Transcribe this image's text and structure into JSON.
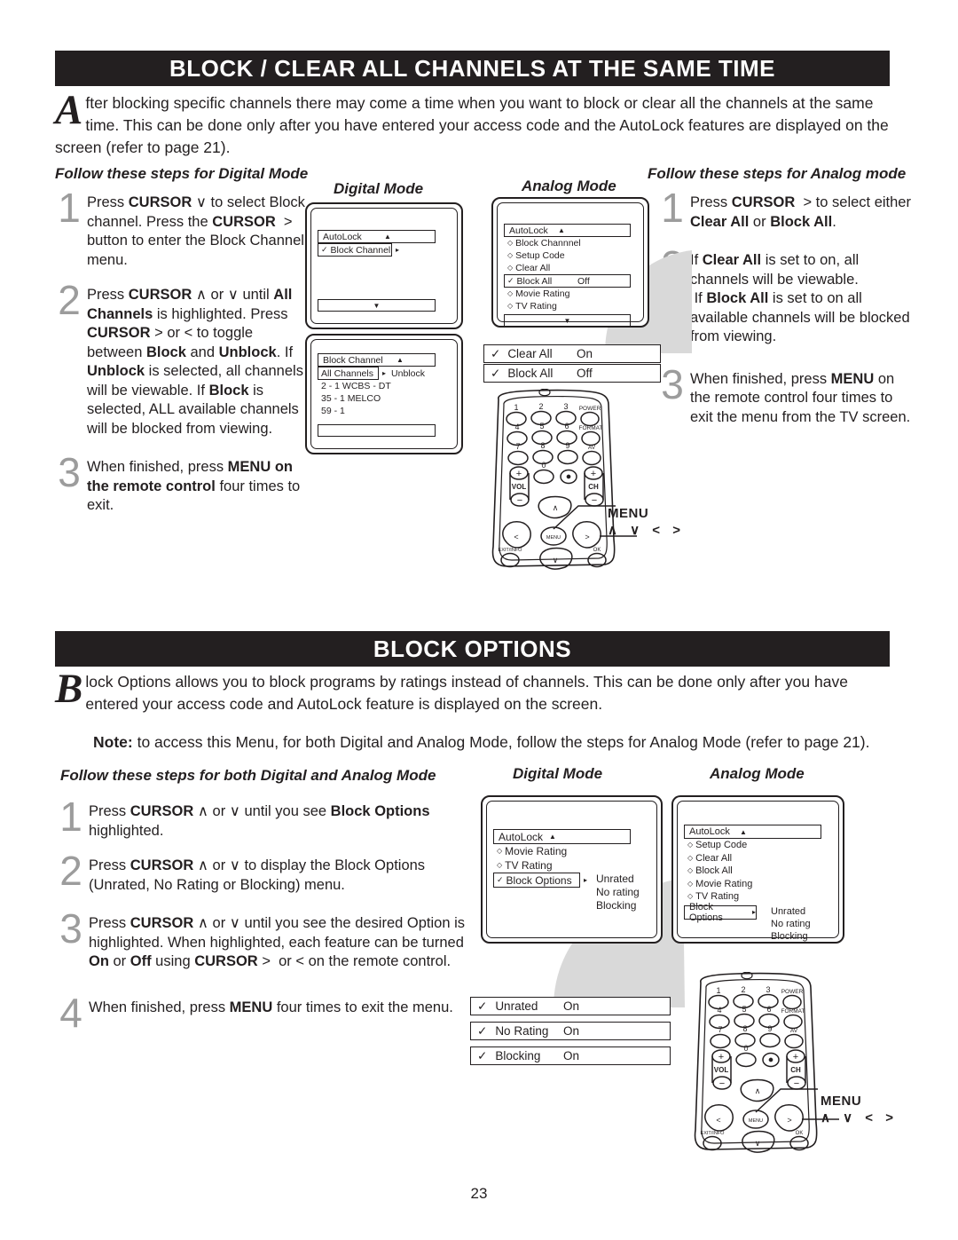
{
  "page_number": "23",
  "sections": [
    {
      "id": "block-clear-all",
      "banner_title": "BLOCK / CLEAR ALL CHANNELS AT THE SAME TIME",
      "intro_dropcap": "A",
      "intro_text": "fter blocking specific channels there may come a time when you want to block or clear all the channels at the same time.  This can be done only after you have entered your access code and the AutoLock features are displayed on the screen (refer to page 21).",
      "left_heading": "Follow these steps for Digital Mode",
      "right_heading": "Follow these steps for Analog mode",
      "left_steps": [
        {
          "num": "1",
          "html": "Press <b>CURSOR</b> &#8744; to select Block channel. Press the <b>CURSOR</b> &nbsp;&gt; button to enter the Block Channel menu."
        },
        {
          "num": "2",
          "html": "Press <b>CURSOR</b> &#8743; or &#8744; until <b>All Channels</b> is highlighted.  Press <b>CURSOR</b> &gt; or &lt; to toggle between <b>Block</b> and <b>Unblock</b>.  If <b>Unblock</b> is selected, all channels will be viewable.   If <b>Block</b> is selected,  ALL available channels will be blocked from viewing."
        },
        {
          "num": "3",
          "html": "When finished, press <b>MENU on the remote control</b> four times to exit."
        }
      ],
      "right_steps": [
        {
          "num": "1",
          "html": "Press <b>CURSOR</b> &nbsp;&gt; to select either <b>Clear All</b> or <b>Block All</b>."
        },
        {
          "num": "2",
          "html": "If <b>Clear All</b> is set to on, all channels will be viewable.<br>&nbsp;If <b>Block All</b> is set to on all available channels will be blocked from viewing."
        },
        {
          "num": "3",
          "html": "When finished, press <b>MENU</b> on the remote control four times to exit the menu from the TV screen."
        }
      ],
      "digital_mode_label": "Digital Mode",
      "analog_mode_label": "Analog Mode",
      "digital_screen_1": {
        "title": "AutoLock",
        "up_arrow": "▲",
        "selected": {
          "check": "✓",
          "label": "Block Channel",
          "arrow": "▸"
        },
        "footer_arrow": "▼"
      },
      "digital_screen_2": {
        "title": "Block Channel",
        "up_arrow": "▲",
        "selected": {
          "label": "All Channels",
          "arrow": "▸",
          "value": "Unblock"
        },
        "rows": [
          "2   - 1 WCBS - DT",
          "35 - 1 MELCO",
          "59 - 1"
        ]
      },
      "analog_screen": {
        "title": "AutoLock",
        "up_arrow": "▲",
        "rows": [
          {
            "label": "Block Channnel"
          },
          {
            "label": "Setup Code"
          },
          {
            "label": "Clear All"
          }
        ],
        "selected": {
          "check": "✓",
          "label": "Block All",
          "value": "Off"
        },
        "rows_after": [
          {
            "label": "Movie Rating"
          },
          {
            "label": "TV Rating"
          }
        ],
        "footer_arrow": "▼"
      },
      "option_bars": [
        {
          "check": "✓",
          "label": "Clear All",
          "value": "On"
        },
        {
          "check": "✓",
          "label": "Block All",
          "value": "Off"
        }
      ]
    },
    {
      "id": "block-options",
      "banner_title": "BLOCK OPTIONS",
      "intro_dropcap": "B",
      "intro_text": "lock Options allows you to block programs by ratings instead of channels.   This can be done only after you have entered your access code and AutoLock feature is displayed on the screen.",
      "note_label": "Note:",
      "note_text": " to access this Menu, for both Digital and Analog Mode, follow the steps for Analog Mode (refer to page 21).",
      "heading": "Follow these steps for both Digital and Analog Mode",
      "steps": [
        {
          "num": "1",
          "html": "Press <b>CURSOR</b> &#8743; or &#8744; until you see <b>Block Options</b> highlighted."
        },
        {
          "num": "2",
          "html": "Press <b>CURSOR</b> &#8743; or &#8744; to display the Block Options (Unrated, No Rating or Blocking) menu."
        },
        {
          "num": "3",
          "html": "Press <b>CURSOR</b> &#8743; or &#8744; until you see the desired Option is highlighted.  When highlighted, each feature can be turned <b>On</b> or <b>Off</b> using <b>CURSOR</b> &gt; &nbsp;or &lt; on the remote control."
        },
        {
          "num": "4",
          "html": "When finished, press <b>MENU</b> four times to exit the menu."
        }
      ],
      "digital_mode_label": "Digital Mode",
      "analog_mode_label": "Analog Mode",
      "digital_screen": {
        "title": "AutoLock",
        "up_arrow": "▲",
        "rows": [
          {
            "label": "Movie Rating"
          },
          {
            "label": "TV Rating"
          }
        ],
        "selected": {
          "check": "✓",
          "label": "Block Options",
          "arrow": "▸"
        },
        "submenu": [
          "Unrated",
          "No rating",
          "Blocking"
        ]
      },
      "analog_screen": {
        "title": "AutoLock",
        "up_arrow": "▲",
        "rows": [
          {
            "label": "Setup Code"
          },
          {
            "label": "Clear All"
          },
          {
            "label": "Block All"
          },
          {
            "label": "Movie Rating"
          },
          {
            "label": "TV Rating"
          }
        ],
        "selected": {
          "label": "Block Options",
          "arrow": "▸"
        },
        "submenu": [
          "Unrated",
          "No rating",
          "Blocking"
        ]
      },
      "option_bars": [
        {
          "check": "✓",
          "label": "Unrated",
          "value": "On"
        },
        {
          "check": "✓",
          "label": "No Rating",
          "value": "On"
        },
        {
          "check": "✓",
          "label": "Blocking",
          "value": "On"
        }
      ]
    }
  ],
  "remote": {
    "keys": [
      "1",
      "2",
      "3",
      "POWER",
      "4",
      "5",
      "6",
      "FORMAT",
      "7",
      "8",
      "9",
      "AV"
    ],
    "zero": "0",
    "dot": "·",
    "vol_label": "VOL",
    "ch_label": "CH",
    "plus": "+",
    "minus": "−",
    "menu_btn": "MENU",
    "exit_info": "EXIT/INFO",
    "ok": "OK",
    "callout_menu": "MENU",
    "callout_arrows": "∧ ∨ < >"
  },
  "colors": {
    "banner_bg": "#231f20",
    "text": "#231f20",
    "step_number": "#9c9c9c",
    "swoosh": "#d9d9d9"
  }
}
